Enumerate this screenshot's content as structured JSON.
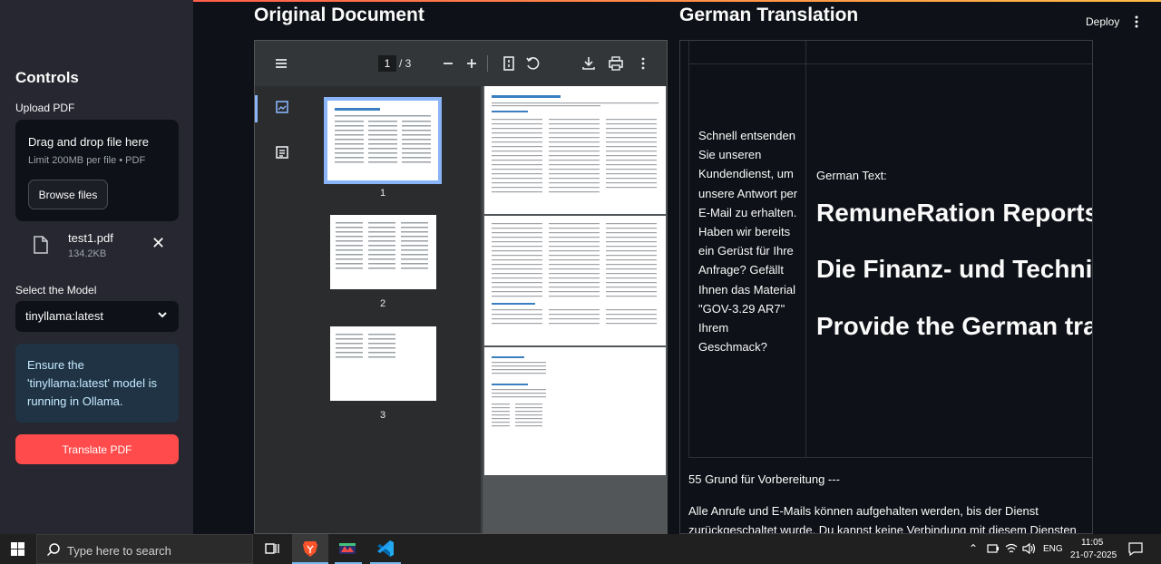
{
  "sidebar": {
    "title": "Controls",
    "upload_label": "Upload PDF",
    "uploader": {
      "drop_text": "Drag and drop file here",
      "limit_text": "Limit 200MB per file • PDF",
      "browse_label": "Browse files"
    },
    "file": {
      "name": "test1.pdf",
      "size": "134.2KB"
    },
    "model_label": "Select the Model",
    "model_value": "tinyllama:latest",
    "info_text": "Ensure the 'tinyllama:latest' model is running in Ollama.",
    "translate_label": "Translate PDF"
  },
  "header": {
    "original_title": "Original Document",
    "translation_title": "German Translation",
    "deploy_label": "Deploy"
  },
  "viewer": {
    "page_current": "1",
    "page_total": "/ 3",
    "thumbnails": [
      "1",
      "2",
      "3"
    ]
  },
  "translation": {
    "cell_text": "Schnell entsenden Sie unseren Kundendienst, um unsere Antwort per E-Mail zu erhalten. Haben wir bereits ein Gerüst für Ihre Anfrage? Gefällt Ihnen das Material \"GOV-3.29 AR7\" Ihrem Geschmack?",
    "german_text_label": "German Text:",
    "heading1": "RemuneRation Reports",
    "heading2": "Die Finanz- und Technike",
    "heading3": "Provide the German tran",
    "para1": "55 Grund für Vorbereitung ---",
    "para2": "Alle Anrufe und E-Mails können aufgehalten werden, bis der Dienst zurückgeschaltet wurde. Du kannst keine Verbindung mit diesem Diensten"
  },
  "taskbar": {
    "search_placeholder": "Type here to search",
    "language": "ENG",
    "time": "11:05",
    "date": "21-07-2025"
  },
  "colors": {
    "primary": "#ff4b4b",
    "sidebar_bg": "#262730",
    "app_bg": "#0e1117",
    "info_bg": "#1f3345",
    "viewer_accent": "#8ab4f8"
  },
  "icons": [
    "file-icon",
    "close-icon",
    "chevron-down-icon",
    "kebab-menu-icon",
    "hamburger-icon",
    "zoom-out-icon",
    "zoom-in-icon",
    "fit-page-icon",
    "rotate-icon",
    "download-icon",
    "print-icon",
    "thumbnail-view-icon",
    "outline-view-icon",
    "windows-start-icon",
    "search-icon",
    "task-view-icon",
    "brave-icon",
    "app-icon",
    "vscode-icon",
    "wifi-icon",
    "volume-icon",
    "notification-icon"
  ]
}
